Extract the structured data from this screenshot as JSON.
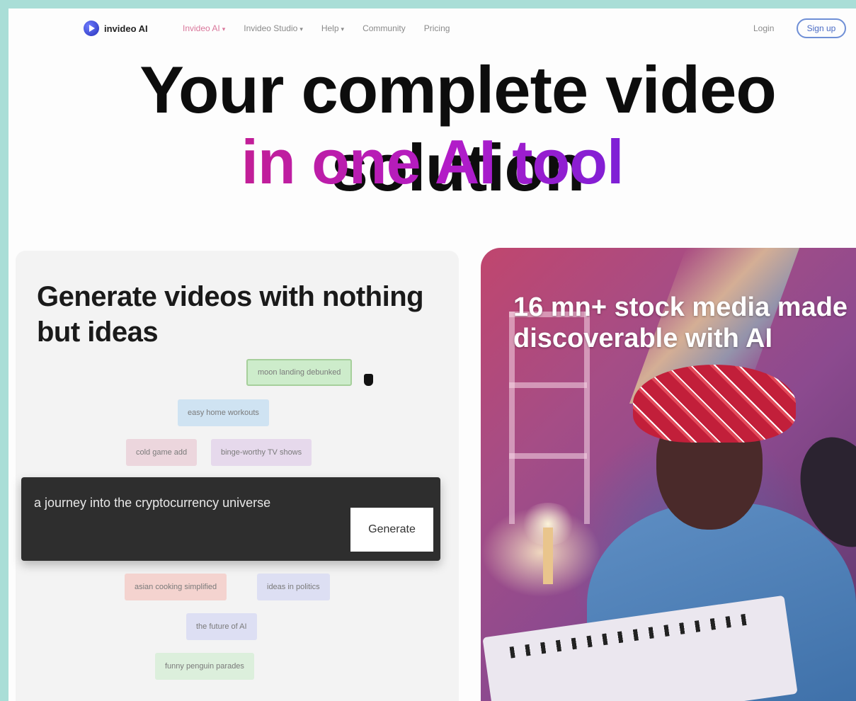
{
  "nav": {
    "logo_text": "invideo AI",
    "items": [
      {
        "label": "Invideo AI",
        "chevron": "chevron-down-icon",
        "active": true
      },
      {
        "label": "Invideo Studio",
        "chevron": "chevron-down-icon",
        "active": false
      },
      {
        "label": "Help",
        "chevron": "chevron-down-icon",
        "active": false
      },
      {
        "label": "Community"
      },
      {
        "label": "Pricing"
      }
    ],
    "login_label": "Login",
    "signup_label": "Sign up"
  },
  "hero": {
    "line1": "Your complete video solution",
    "line2": "in one AI tool"
  },
  "left_card": {
    "title": "Generate videos with nothing but ideas",
    "chips": [
      "moon landing debunked",
      "easy home workouts",
      "cold game add",
      "binge-worthy TV shows",
      "asian cooking simplified",
      "ideas in politics",
      "the future of AI",
      "funny penguin parades"
    ],
    "prompt_value": "a journey into the cryptocurrency universe",
    "generate_label": "Generate"
  },
  "right_card": {
    "title": "16 mn+ stock media made discoverable with AI"
  },
  "colors": {
    "accent_pink": "#d9779b",
    "hero_gradient_start": "#c21e96",
    "hero_gradient_end": "#7d1fd6",
    "frame_border": "#a9ded7"
  }
}
